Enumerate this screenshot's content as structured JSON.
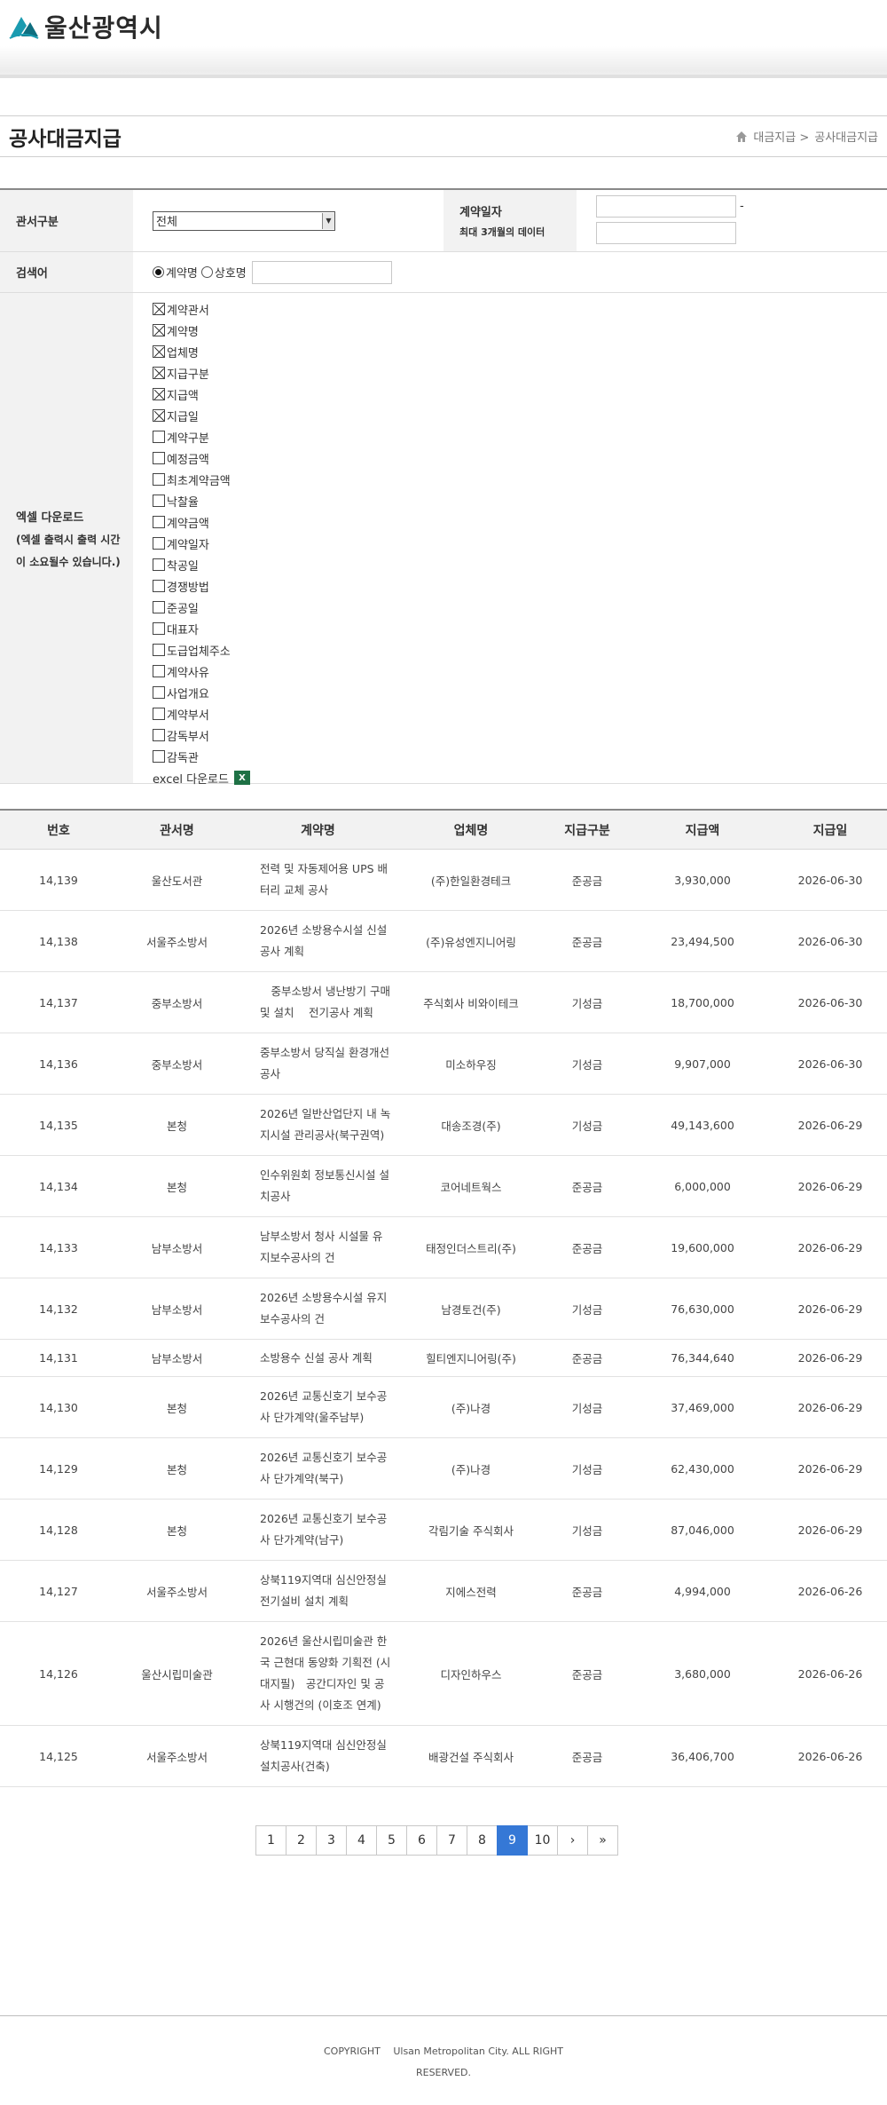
{
  "header": {
    "logo_text": "울산광역시",
    "logo_icon": "ulsan-logo-icon",
    "brand_color": "#1a9bb0"
  },
  "page": {
    "title": "공사대금지급"
  },
  "breadcrumb": {
    "home_icon": "home-icon",
    "level1": "대금지급 >",
    "level2": "공사대금지급"
  },
  "search": {
    "office_label": "관서구분",
    "office_value": "전체",
    "contract_date_label": "계약일자",
    "contract_date_note": "최대 3개월의 데이터",
    "date_separator": "-",
    "keyword_label": "검색어",
    "radio_contract": "계약명",
    "radio_company": "상호명",
    "excel_label": "엑셀 다운로드",
    "excel_note1": "(엑셀 출력시 출력 시간",
    "excel_note2": "이 소요될수 있습니다.)",
    "excel_link": "excel 다운로드",
    "fields": [
      {
        "label": "계약관서",
        "checked": true
      },
      {
        "label": "계약명",
        "checked": true
      },
      {
        "label": "업체명",
        "checked": true
      },
      {
        "label": "지급구분",
        "checked": true
      },
      {
        "label": "지급액",
        "checked": true
      },
      {
        "label": "지급일",
        "checked": true
      },
      {
        "label": "계약구분",
        "checked": false
      },
      {
        "label": "예정금액",
        "checked": false
      },
      {
        "label": "최초계약금액",
        "checked": false
      },
      {
        "label": "낙찰율",
        "checked": false
      },
      {
        "label": "계약금액",
        "checked": false
      },
      {
        "label": "계약일자",
        "checked": false
      },
      {
        "label": "착공일",
        "checked": false
      },
      {
        "label": "경쟁방법",
        "checked": false
      },
      {
        "label": "준공일",
        "checked": false
      },
      {
        "label": "대표자",
        "checked": false
      },
      {
        "label": "도급업체주소",
        "checked": false
      },
      {
        "label": "계약사유",
        "checked": false
      },
      {
        "label": "사업개요",
        "checked": false
      },
      {
        "label": "계약부서",
        "checked": false
      },
      {
        "label": "감독부서",
        "checked": false
      },
      {
        "label": "감독관",
        "checked": false
      }
    ]
  },
  "table": {
    "headers": [
      "번호",
      "관서명",
      "계약명",
      "업체명",
      "지급구분",
      "지급액",
      "지급일"
    ],
    "rows": [
      {
        "no": "14,139",
        "office": "울산도서관",
        "name": "전력 및 자동제어용 UPS 배터리 교체 공사",
        "company": "(주)한일환경테크",
        "type": "준공금",
        "amount": "3,930,000",
        "date": "2026-06-30"
      },
      {
        "no": "14,138",
        "office": "서울주소방서",
        "name": "2026년 소방용수시설 신설공사 계획",
        "company": "(주)유성엔지니어링",
        "type": "준공금",
        "amount": "23,494,500",
        "date": "2026-06-30"
      },
      {
        "no": "14,137",
        "office": "중부소방서",
        "name": "　중부소방서 냉난방기 구매 및 설치　 전기공사 계획",
        "company": "주식회사 비와이테크",
        "type": "기성금",
        "amount": "18,700,000",
        "date": "2026-06-30"
      },
      {
        "no": "14,136",
        "office": "중부소방서",
        "name": "중부소방서 당직실 환경개선 공사",
        "company": "미소하우징",
        "type": "기성금",
        "amount": "9,907,000",
        "date": "2026-06-30"
      },
      {
        "no": "14,135",
        "office": "본청",
        "name": "2026년 일반산업단지 내 녹지시설 관리공사(북구권역)",
        "company": "대송조경(주)",
        "type": "기성금",
        "amount": "49,143,600",
        "date": "2026-06-29"
      },
      {
        "no": "14,134",
        "office": "본청",
        "name": "인수위원회 정보통신시설 설치공사",
        "company": "코어네트웍스",
        "type": "준공금",
        "amount": "6,000,000",
        "date": "2026-06-29"
      },
      {
        "no": "14,133",
        "office": "남부소방서",
        "name": "남부소방서 청사 시설물 유지보수공사의 건",
        "company": "태정인더스트리(주)",
        "type": "준공금",
        "amount": "19,600,000",
        "date": "2026-06-29"
      },
      {
        "no": "14,132",
        "office": "남부소방서",
        "name": "2026년 소방용수시설 유지보수공사의 건",
        "company": "남경토건(주)",
        "type": "기성금",
        "amount": "76,630,000",
        "date": "2026-06-29"
      },
      {
        "no": "14,131",
        "office": "남부소방서",
        "name": "소방용수 신설 공사 계획",
        "company": "힐티엔지니어링(주)",
        "type": "준공금",
        "amount": "76,344,640",
        "date": "2026-06-29"
      },
      {
        "no": "14,130",
        "office": "본청",
        "name": "2026년 교통신호기 보수공사 단가계약(울주남부)",
        "company": "(주)나경",
        "type": "기성금",
        "amount": "37,469,000",
        "date": "2026-06-29"
      },
      {
        "no": "14,129",
        "office": "본청",
        "name": "2026년 교통신호기 보수공사 단가계약(북구)",
        "company": "(주)나경",
        "type": "기성금",
        "amount": "62,430,000",
        "date": "2026-06-29"
      },
      {
        "no": "14,128",
        "office": "본청",
        "name": "2026년 교통신호기 보수공사 단가계약(남구)",
        "company": "각림기술 주식회사",
        "type": "기성금",
        "amount": "87,046,000",
        "date": "2026-06-29"
      },
      {
        "no": "14,127",
        "office": "서울주소방서",
        "name": "상북119지역대 심신안정실 전기설비 설치 계획",
        "company": "지에스전력",
        "type": "준공금",
        "amount": "4,994,000",
        "date": "2026-06-26"
      },
      {
        "no": "14,126",
        "office": "울산시립미술관",
        "name": "2026년 울산시립미술관 한국 근현대 동양화 기획전 (시대지필)　공간디자인 및 공사 시행건의 (이호조 연계)",
        "company": "디자인하우스",
        "type": "준공금",
        "amount": "3,680,000",
        "date": "2026-06-26"
      },
      {
        "no": "14,125",
        "office": "서울주소방서",
        "name": "상북119지역대 심신안정실 설치공사(건축)",
        "company": "배광건설 주식회사",
        "type": "준공금",
        "amount": "36,406,700",
        "date": "2026-06-26"
      }
    ]
  },
  "pagination": {
    "pages": [
      "1",
      "2",
      "3",
      "4",
      "5",
      "6",
      "7",
      "8",
      "9",
      "10"
    ],
    "current": "9",
    "next": "›",
    "last": "»",
    "active_color": "#3578d6"
  },
  "footer": {
    "copyright_line1": "COPYRIGHT　 Ulsan Metropolitan City. ALL RIGHT",
    "copyright_line2": "RESERVED."
  }
}
